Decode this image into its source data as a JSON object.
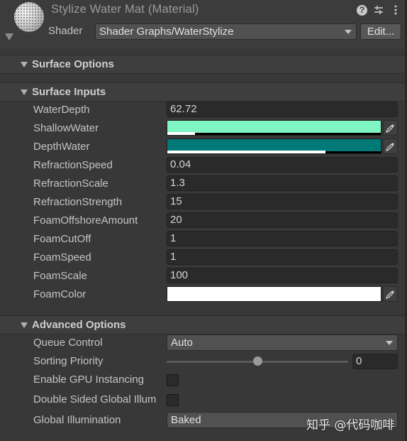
{
  "header": {
    "title": "Stylize Water Mat (Material)",
    "shader_label": "Shader",
    "shader_value": "Shader Graphs/WaterStylize",
    "edit_label": "Edit...",
    "icons": [
      "help-icon",
      "sliders-icon",
      "more-icon"
    ]
  },
  "sections": {
    "surface_options": "Surface Options",
    "surface_inputs": "Surface Inputs",
    "advanced_options": "Advanced Options"
  },
  "inputs": {
    "water_depth": {
      "label": "WaterDepth",
      "value": "62.72"
    },
    "shallow_water": {
      "label": "ShallowWater",
      "color": "#7ff5c4",
      "alpha": 0.13
    },
    "depth_water": {
      "label": "DepthWater",
      "color": "#007a78",
      "alpha": 0.74
    },
    "refraction_speed": {
      "label": "RefractionSpeed",
      "value": "0.04"
    },
    "refraction_scale": {
      "label": "RefractionScale",
      "value": "1.3"
    },
    "refraction_strength": {
      "label": "RefractionStrength",
      "value": "15"
    },
    "foam_offshore_amount": {
      "label": "FoamOffshoreAmount",
      "value": "20"
    },
    "foam_cutoff": {
      "label": "FoamCutOff",
      "value": "1"
    },
    "foam_speed": {
      "label": "FoamSpeed",
      "value": "1"
    },
    "foam_scale": {
      "label": "FoamScale",
      "value": "100"
    },
    "foam_color": {
      "label": "FoamColor",
      "color": "#ffffff",
      "alpha": 1.0
    }
  },
  "advanced": {
    "queue_control": {
      "label": "Queue Control",
      "value": "Auto"
    },
    "sorting_priority": {
      "label": "Sorting Priority",
      "value": "0",
      "slider_fraction": 0.5
    },
    "gpu_instancing": {
      "label": "Enable GPU Instancing",
      "checked": false
    },
    "double_sided_gi": {
      "label": "Double Sided Global Illum",
      "checked": false
    },
    "global_illumination": {
      "label": "Global Illumination",
      "value": "Baked"
    }
  },
  "watermark": "知乎 @代码咖啡"
}
